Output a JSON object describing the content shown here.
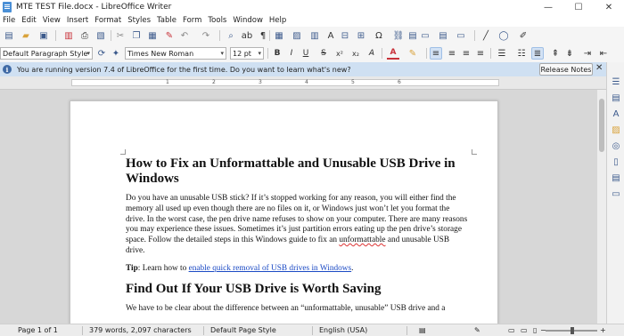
{
  "window": {
    "title": "MTE TEST File.docx - LibreOffice Writer",
    "minimize_icon": "minimize-icon",
    "maximize_icon": "maximize-icon",
    "close_icon": "close-icon",
    "minimize_glyph": "—",
    "maximize_glyph": "☐",
    "close_glyph": "✕"
  },
  "menu": {
    "items": [
      "File",
      "Edit",
      "View",
      "Insert",
      "Format",
      "Styles",
      "Table",
      "Form",
      "Tools",
      "Window",
      "Help"
    ]
  },
  "formatting": {
    "paragraph_style": "Default Paragraph Style",
    "font_name": "Times New Roman",
    "font_size": "12 pt"
  },
  "infobar": {
    "message": "You are running version 7.4 of LibreOffice for the first time. Do you want to learn what's new?",
    "button": "Release Notes",
    "close_glyph": "✕",
    "icon_glyph": "i"
  },
  "ruler": {
    "labels": [
      "1",
      "2",
      "3",
      "4",
      "5",
      "6"
    ]
  },
  "document": {
    "heading1": "How to Fix an Unformattable and Unusable USB Drive in Windows",
    "para1": "Do you have an unusable USB stick? If it’s stopped working for any reason, you will either find the memory all used up even though there are no files on it, or Windows just won’t let you format the drive. In the worst case, the pen drive name refuses to show on your computer. There are many reasons you may experience these issues. Sometimes it’s just partition errors eating up the pen drive’s storage space. Follow the detailed steps in this Windows guide to fix an",
    "para1_end": "unformattable",
    "para1_tail": " and unusable USB drive.",
    "tip_label": "Tip",
    "tip_text": ": Learn how to ",
    "tip_link": "enable quick removal of USB drives in Windows",
    "tip_end": ".",
    "heading2": "Find Out If Your USB Drive is Worth Saving",
    "para2": "We have to be clear about the difference between an “unformattable, unusable” USB drive and a"
  },
  "status": {
    "page": "Page 1 of 1",
    "words": "379 words, 2,097 characters",
    "page_style": "Default Page Style",
    "language": "English (USA)"
  },
  "colors": {
    "accent": "#3c5a8c",
    "infobar_bg": "#cfe0f2",
    "link": "#1a49c4"
  }
}
